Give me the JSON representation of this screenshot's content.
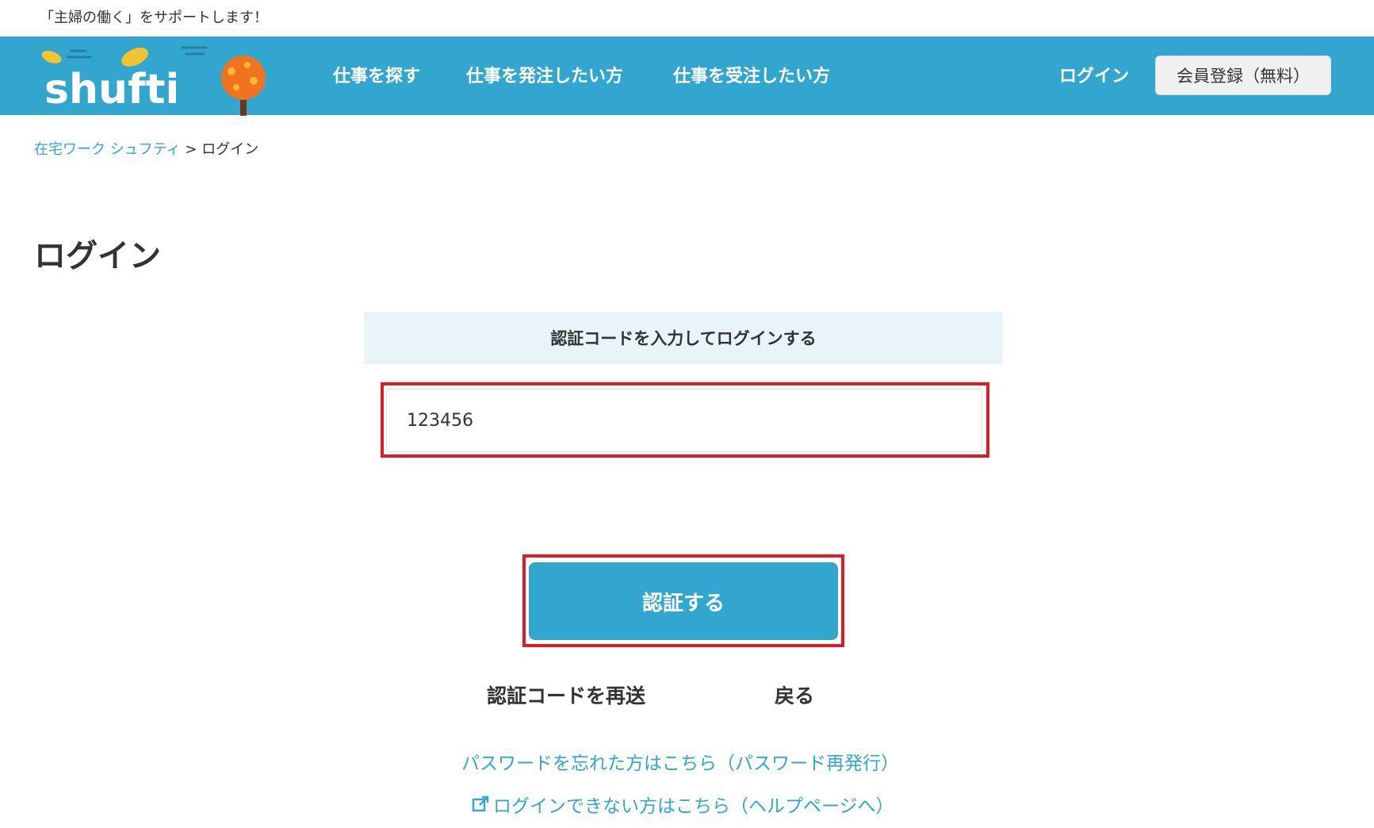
{
  "tagline": "「主婦の働く」をサポートします！",
  "header": {
    "logo_text": "shufti",
    "nav": [
      {
        "label": "仕事を探す"
      },
      {
        "label": "仕事を発注したい方"
      },
      {
        "label": "仕事を受注したい方"
      }
    ],
    "login_label": "ログイン",
    "signup_label": "会員登録（無料）"
  },
  "breadcrumb": {
    "home": "在宅ワーク シュフティ",
    "separator": ">",
    "current": "ログイン"
  },
  "page": {
    "title": "ログイン",
    "panel_title": "認証コードを入力してログインする",
    "code_value": "123456",
    "submit_label": "認証する",
    "resend_label": "認証コードを再送",
    "back_label": "戻る",
    "forgot_label": "パスワードを忘れた方はこちら（パスワード再発行）",
    "help_label": "ログインできない方はこちら（ヘルプページへ）"
  },
  "colors": {
    "brand": "#33a6cf",
    "highlight": "#e01b24",
    "panel_bg": "#e9f4f9",
    "tree_orange": "#f0731f"
  }
}
